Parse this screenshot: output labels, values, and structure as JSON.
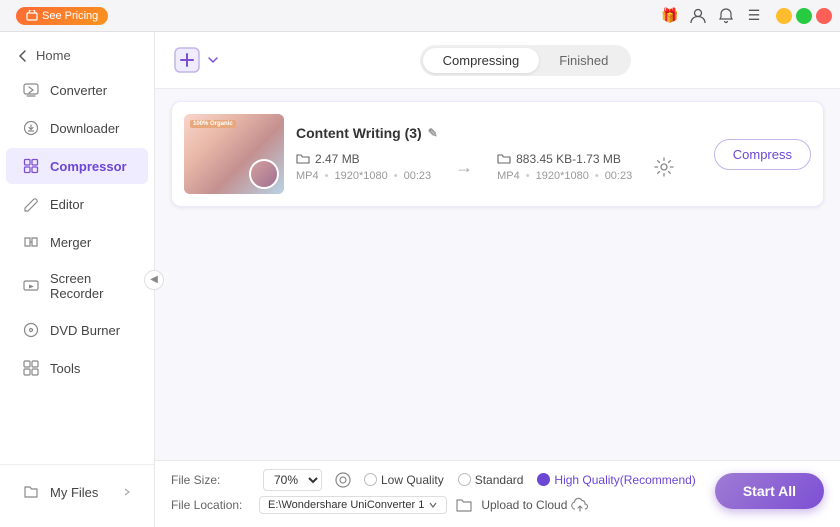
{
  "titlebar": {
    "promo_label": "See Pricing",
    "window_controls": [
      "minimize",
      "maximize",
      "close"
    ]
  },
  "sidebar": {
    "back_label": "Home",
    "items": [
      {
        "id": "converter",
        "label": "Converter",
        "active": false
      },
      {
        "id": "downloader",
        "label": "Downloader",
        "active": false
      },
      {
        "id": "compressor",
        "label": "Compressor",
        "active": true
      },
      {
        "id": "editor",
        "label": "Editor",
        "active": false
      },
      {
        "id": "merger",
        "label": "Merger",
        "active": false
      },
      {
        "id": "screen-recorder",
        "label": "Screen Recorder",
        "active": false
      },
      {
        "id": "dvd-burner",
        "label": "DVD Burner",
        "active": false
      },
      {
        "id": "tools",
        "label": "Tools",
        "active": false
      }
    ],
    "bottom_items": [
      {
        "id": "my-files",
        "label": "My Files"
      }
    ]
  },
  "header": {
    "tabs": [
      {
        "id": "compressing",
        "label": "Compressing",
        "active": true
      },
      {
        "id": "finished",
        "label": "Finished",
        "active": false
      }
    ]
  },
  "file_card": {
    "name": "Content Writing (3)",
    "thumbnail_text": "100% Organic",
    "input": {
      "icon": "folder",
      "size": "2.47 MB",
      "format": "MP4",
      "resolution": "1920*1080",
      "duration": "00:23"
    },
    "output": {
      "icon": "folder",
      "size_range": "883.45 KB-1.73 MB",
      "format": "MP4",
      "resolution": "1920*1080",
      "duration": "00:23"
    },
    "compress_btn": "Compress"
  },
  "bottom_bar": {
    "file_size_label": "File Size:",
    "file_size_value": "70%",
    "quality_options": [
      {
        "id": "low",
        "label": "Low Quality",
        "selected": false
      },
      {
        "id": "standard",
        "label": "Standard",
        "selected": false
      },
      {
        "id": "high",
        "label": "High Quality(Recommend)",
        "selected": true
      }
    ],
    "file_location_label": "File Location:",
    "file_location_path": "E:\\Wondershare UniConverter 1",
    "upload_label": "Upload to Cloud"
  },
  "start_btn": "Start All",
  "colors": {
    "accent": "#7c4fd4",
    "accent_light": "#f0ecff"
  }
}
